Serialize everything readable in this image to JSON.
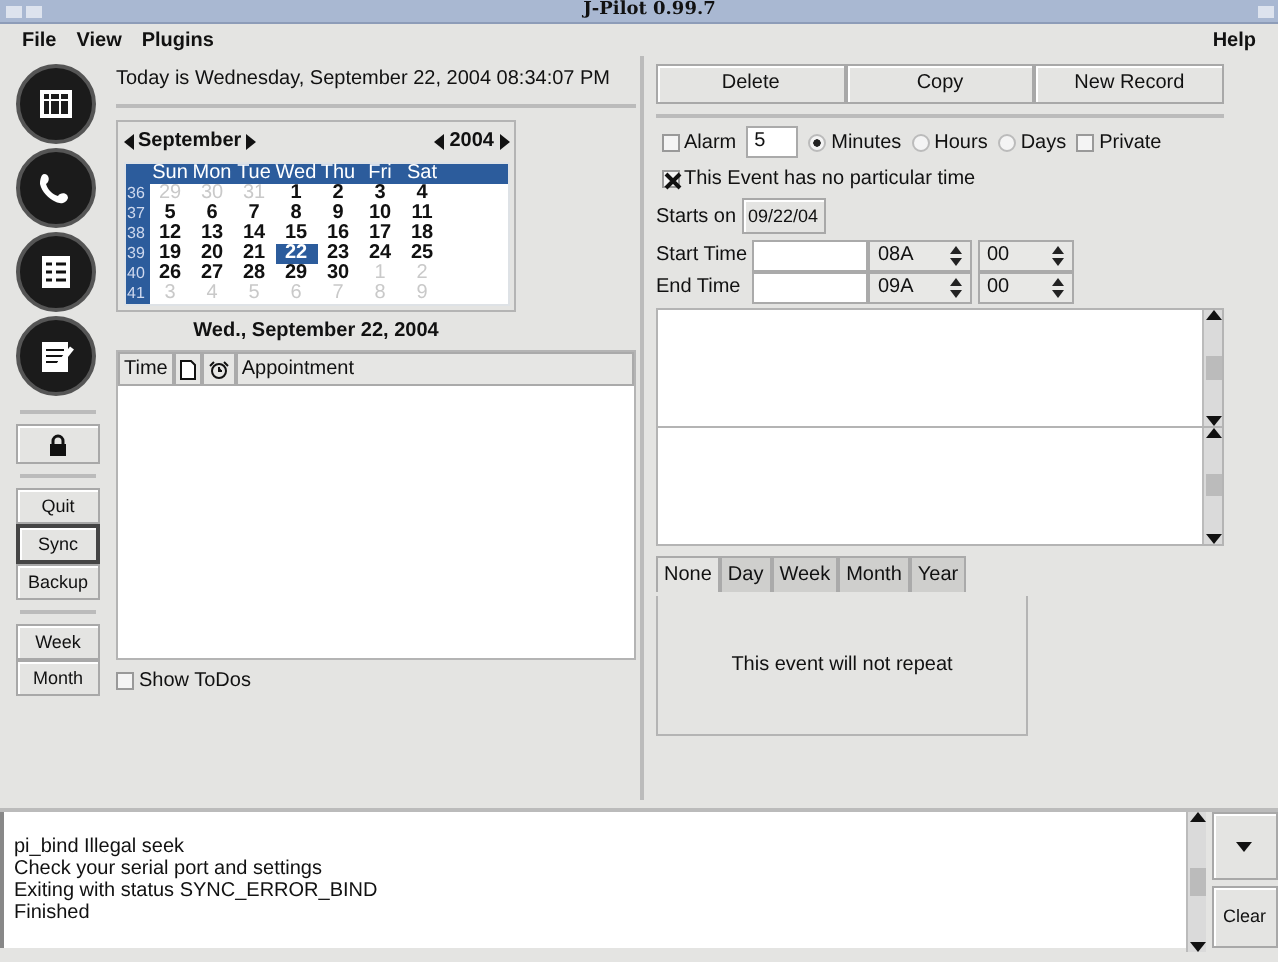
{
  "window": {
    "title": "J-Pilot 0.99.7"
  },
  "menu": [
    {
      "label": "File"
    },
    {
      "label": "View"
    },
    {
      "label": "Plugins"
    }
  ],
  "help_menu": {
    "label": "Help"
  },
  "app_buttons": [
    {
      "kind": "datebook"
    },
    {
      "kind": "address"
    },
    {
      "kind": "todo"
    },
    {
      "kind": "memo"
    }
  ],
  "side_button_groups": [
    {
      "buttons": [
        {
          "label": "Quit",
          "focused": false
        },
        {
          "label": "Sync",
          "focused": true
        },
        {
          "label": "Backup",
          "focused": false
        }
      ]
    },
    {
      "buttons": [
        {
          "label": "Week",
          "focused": false
        },
        {
          "label": "Month",
          "focused": false
        }
      ]
    }
  ],
  "today": "Today is Wednesday, September 22, 2004 08:34:07 PM",
  "calendar": {
    "month": "September",
    "year": "2004",
    "weekdays": [
      "Sun",
      "Mon",
      "Tue",
      "Wed",
      "Thu",
      "Fri",
      "Sat"
    ],
    "weeks": [
      {
        "number": "36",
        "days": [
          {
            "day": "29",
            "other": true,
            "selected": false
          },
          {
            "day": "30",
            "other": true,
            "selected": false
          },
          {
            "day": "31",
            "other": true,
            "selected": false
          },
          {
            "day": "1",
            "other": false,
            "selected": false
          },
          {
            "day": "2",
            "other": false,
            "selected": false
          },
          {
            "day": "3",
            "other": false,
            "selected": false
          },
          {
            "day": "4",
            "other": false,
            "selected": false
          }
        ]
      },
      {
        "number": "37",
        "days": [
          {
            "day": "5",
            "other": false,
            "selected": false
          },
          {
            "day": "6",
            "other": false,
            "selected": false
          },
          {
            "day": "7",
            "other": false,
            "selected": false
          },
          {
            "day": "8",
            "other": false,
            "selected": false
          },
          {
            "day": "9",
            "other": false,
            "selected": false
          },
          {
            "day": "10",
            "other": false,
            "selected": false
          },
          {
            "day": "11",
            "other": false,
            "selected": false
          }
        ]
      },
      {
        "number": "38",
        "days": [
          {
            "day": "12",
            "other": false,
            "selected": false
          },
          {
            "day": "13",
            "other": false,
            "selected": false
          },
          {
            "day": "14",
            "other": false,
            "selected": false
          },
          {
            "day": "15",
            "other": false,
            "selected": false
          },
          {
            "day": "16",
            "other": false,
            "selected": false
          },
          {
            "day": "17",
            "other": false,
            "selected": false
          },
          {
            "day": "18",
            "other": false,
            "selected": false
          }
        ]
      },
      {
        "number": "39",
        "days": [
          {
            "day": "19",
            "other": false,
            "selected": false
          },
          {
            "day": "20",
            "other": false,
            "selected": false
          },
          {
            "day": "21",
            "other": false,
            "selected": false
          },
          {
            "day": "22",
            "other": false,
            "selected": true
          },
          {
            "day": "23",
            "other": false,
            "selected": false
          },
          {
            "day": "24",
            "other": false,
            "selected": false
          },
          {
            "day": "25",
            "other": false,
            "selected": false
          }
        ]
      },
      {
        "number": "40",
        "days": [
          {
            "day": "26",
            "other": false,
            "selected": false
          },
          {
            "day": "27",
            "other": false,
            "selected": false
          },
          {
            "day": "28",
            "other": false,
            "selected": false
          },
          {
            "day": "29",
            "other": false,
            "selected": false
          },
          {
            "day": "30",
            "other": false,
            "selected": false
          },
          {
            "day": "1",
            "other": true,
            "selected": false
          },
          {
            "day": "2",
            "other": true,
            "selected": false
          }
        ]
      },
      {
        "number": "41",
        "days": [
          {
            "day": "3",
            "other": true,
            "selected": false
          },
          {
            "day": "4",
            "other": true,
            "selected": false
          },
          {
            "day": "5",
            "other": true,
            "selected": false
          },
          {
            "day": "6",
            "other": true,
            "selected": false
          },
          {
            "day": "7",
            "other": true,
            "selected": false
          },
          {
            "day": "8",
            "other": true,
            "selected": false
          },
          {
            "day": "9",
            "other": true,
            "selected": false
          }
        ]
      }
    ],
    "selected_date": "Wed., September 22, 2004"
  },
  "appointments": {
    "columns": [
      {
        "kind": "text",
        "label": "Time"
      },
      {
        "kind": "note"
      },
      {
        "kind": "alarm"
      },
      {
        "kind": "text",
        "label": "Appointment"
      }
    ]
  },
  "show_todos": {
    "label": "Show ToDos",
    "checked": false
  },
  "toolbar": [
    {
      "label": "Delete"
    },
    {
      "label": "Copy"
    },
    {
      "label": "New Record"
    }
  ],
  "alarm": {
    "label": "Alarm",
    "checked": false,
    "value": "5",
    "units": [
      {
        "label": "Minutes",
        "selected": true
      },
      {
        "label": "Hours",
        "selected": false
      },
      {
        "label": "Days",
        "selected": false
      }
    ]
  },
  "private": {
    "label": "Private",
    "checked": false
  },
  "no_time": {
    "label": "This Event has no particular time",
    "checked": true
  },
  "starts_on": {
    "label": "Starts on",
    "value": "09/22/04"
  },
  "times": [
    {
      "label": "Start Time",
      "hour": "08A",
      "minute": "00"
    },
    {
      "label": "End Time",
      "hour": "09A",
      "minute": "00"
    }
  ],
  "repeat": {
    "tabs": [
      {
        "label": "None",
        "selected": true
      },
      {
        "label": "Day",
        "selected": false
      },
      {
        "label": "Week",
        "selected": false
      },
      {
        "label": "Month",
        "selected": false
      },
      {
        "label": "Year",
        "selected": false
      }
    ],
    "message": "This event will not repeat"
  },
  "log": {
    "lines": [
      "pi_bind Illegal seek",
      "Check your serial port and settings",
      "Exiting with status SYNC_ERROR_BIND",
      "Finished"
    ]
  },
  "clear_button": {
    "label": "Clear"
  }
}
